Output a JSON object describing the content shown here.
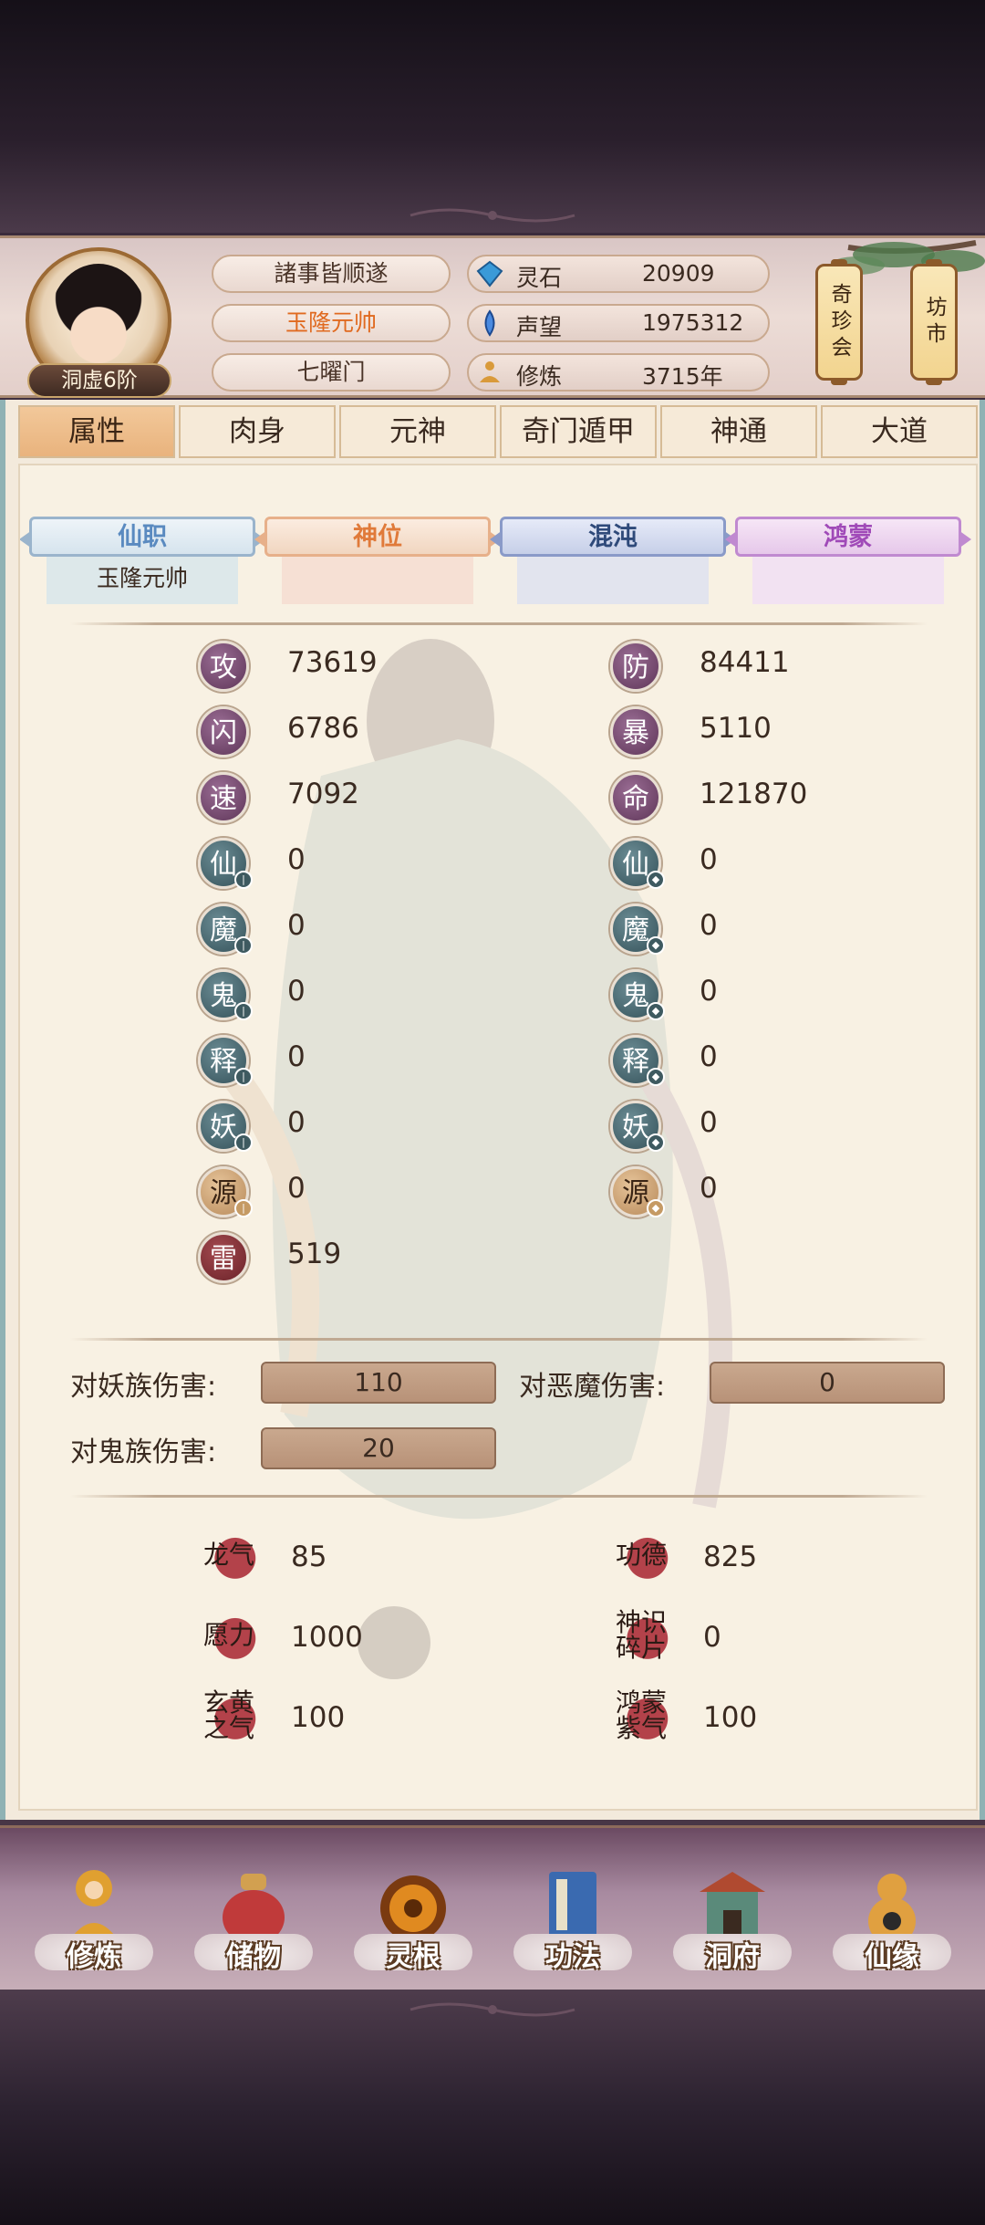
{
  "header": {
    "rank": "洞虚6阶",
    "motto": "諸事皆顺遂",
    "title": "玉隆元帅",
    "sect": "七曜门",
    "resources": [
      {
        "label": "灵石",
        "value": "20909",
        "icon": "gem-icon"
      },
      {
        "label": "声望",
        "value": "1975312",
        "icon": "crystal-icon"
      },
      {
        "label": "修炼",
        "value": "3715年",
        "icon": "meditation-icon"
      }
    ],
    "side_buttons": [
      "奇珍会",
      "坊市"
    ]
  },
  "tabs": [
    "属性",
    "肉身",
    "元神",
    "奇门遁甲",
    "神通",
    "大道"
  ],
  "ribbons": [
    {
      "label": "仙职",
      "value": "玉隆元帅"
    },
    {
      "label": "神位",
      "value": ""
    },
    {
      "label": "混沌",
      "value": ""
    },
    {
      "label": "鸿蒙",
      "value": ""
    }
  ],
  "stats_left": [
    {
      "char": "攻",
      "value": "73619"
    },
    {
      "char": "闪",
      "value": "6786"
    },
    {
      "char": "速",
      "value": "7092"
    },
    {
      "char": "仙",
      "value": "0"
    },
    {
      "char": "魔",
      "value": "0"
    },
    {
      "char": "鬼",
      "value": "0"
    },
    {
      "char": "释",
      "value": "0"
    },
    {
      "char": "妖",
      "value": "0"
    },
    {
      "char": "源",
      "value": "0"
    },
    {
      "char": "雷",
      "value": "519"
    }
  ],
  "stats_right": [
    {
      "char": "防",
      "value": "84411"
    },
    {
      "char": "暴",
      "value": "5110"
    },
    {
      "char": "命",
      "value": "121870"
    },
    {
      "char": "仙",
      "value": "0"
    },
    {
      "char": "魔",
      "value": "0"
    },
    {
      "char": "鬼",
      "value": "0"
    },
    {
      "char": "释",
      "value": "0"
    },
    {
      "char": "妖",
      "value": "0"
    },
    {
      "char": "源",
      "value": "0"
    }
  ],
  "damage": [
    {
      "label": "对妖族伤害:",
      "value": "110"
    },
    {
      "label": "对恶魔伤害:",
      "value": "0"
    },
    {
      "label": "对鬼族伤害:",
      "value": "20"
    }
  ],
  "special": [
    {
      "label": "龙气",
      "value": "85"
    },
    {
      "label": "功德",
      "value": "825"
    },
    {
      "label": "愿力",
      "value": "1000"
    },
    {
      "label": "神识碎片",
      "value": "0"
    },
    {
      "label": "玄黄之气",
      "value": "100"
    },
    {
      "label": "鸿蒙紫气",
      "value": "100"
    }
  ],
  "nav": [
    "修炼",
    "储物",
    "灵根",
    "功法",
    "洞府",
    "仙缘"
  ],
  "colors": {
    "accent_tab": "#e9b37d",
    "xianzhi": "#5a8ac0",
    "shenwei": "#e07a3a",
    "hundun": "#2f4a7a",
    "hongmeng": "#a04ab8",
    "title_orange": "#e06a20"
  }
}
